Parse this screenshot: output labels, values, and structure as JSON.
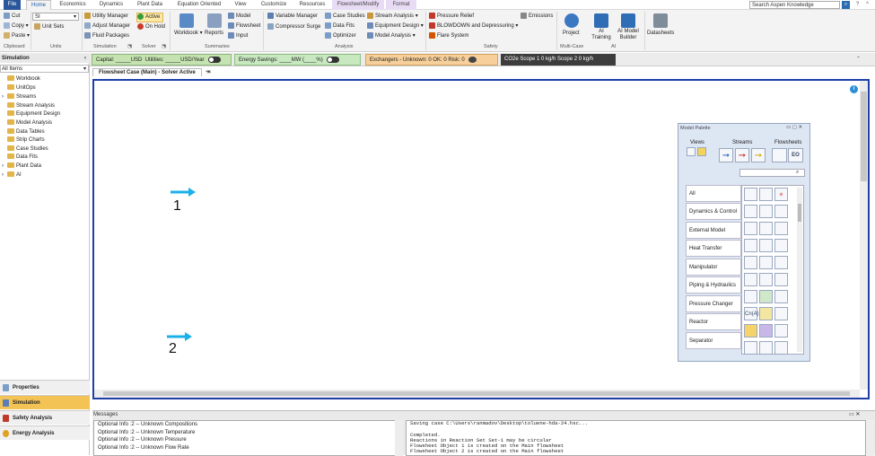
{
  "menu": {
    "tabs": [
      "File",
      "Home",
      "Economics",
      "Dynamics",
      "Plant Data",
      "Equation Oriented",
      "View",
      "Customize",
      "Resources",
      "Flowsheet/Modify",
      "Format"
    ],
    "search_placeholder": "Search Aspen Knowledge"
  },
  "ribbon": {
    "clipboard": {
      "cut": "Cut",
      "copy": "Copy",
      "paste": "Paste",
      "label": "Clipboard"
    },
    "units": {
      "value": "SI",
      "unit_sets": "Unit Sets",
      "label": "Units"
    },
    "simulation": {
      "utility_manager": "Utility Manager",
      "adjust_manager": "Adjust Manager",
      "fluid_packages": "Fluid Packages",
      "label": "Simulation"
    },
    "solver": {
      "active": "Active",
      "on_hold": "On Hold",
      "label": "Solver"
    },
    "summaries": {
      "workbook": "Workbook",
      "reports": "Reports",
      "model": "Model",
      "flowsheet": "Flowsheet",
      "input": "Input",
      "label": "Summaries"
    },
    "analysis": {
      "variable_manager": "Variable Manager",
      "compressor_surge": "Compressor Surge",
      "case_studies": "Case Studies",
      "data_fits": "Data Fits",
      "optimizer": "Optimizer",
      "label": "Analysis"
    },
    "analysis2": {
      "stream_analysis": "Stream Analysis",
      "equipment_design": "Equipment Design",
      "model_analysis": "Model Analysis"
    },
    "safety": {
      "pressure_relief": "Pressure Relief",
      "blowdown": "BLOWDOWN and Depressuring",
      "flare_system": "Flare System",
      "label": "Safety"
    },
    "emissions": "Emissions",
    "multicase": {
      "project": "Project",
      "label": "Multi-Case"
    },
    "ai": {
      "training": "AI Training",
      "builder": "AI Model Builder",
      "label": "AI"
    },
    "datasheets": "Datasheets"
  },
  "costbar": {
    "capital": "Capital: _____USD",
    "utilities": "Utilities: _____USD/Year",
    "energy": "Energy Savings: ____MW   (____%)",
    "exchangers": "Exchangers -  Unknown: 0   OK: 0   Risk: 0",
    "co2": "CO2e Scope 1   0 kg/h   Scope 2   0 kg/h"
  },
  "nav": {
    "header": "Simulation",
    "filter": "All Items",
    "items": [
      "Workbook",
      "UnitOps",
      "Streams",
      "Stream Analysis",
      "Equipment Design",
      "Model Analysis",
      "Data Tables",
      "Strip Charts",
      "Case Studies",
      "Data Fits",
      "Plant Data",
      "AI"
    ],
    "buttons": [
      "Properties",
      "Simulation",
      "Safety Analysis",
      "Energy Analysis"
    ]
  },
  "doc": {
    "tab": "Flowsheet Case (Main) - Solver Active"
  },
  "streams": [
    {
      "label": "1"
    },
    {
      "label": "2"
    }
  ],
  "palette": {
    "title": "Model Palette",
    "views": "Views",
    "streams": "Streams",
    "flowsheets": "Flowsheets",
    "categories": [
      "All",
      "Dynamics & Control",
      "External Model",
      "Heat Transfer",
      "Manipulator",
      "Piping & Hydraulics",
      "Pressure Changer",
      "Reactor",
      "Separator"
    ]
  },
  "messages": {
    "title": "Messages",
    "left": [
      "Optional Info :2 -- Unknown Compositions",
      "Optional Info :2 -- Unknown Temperature",
      "Optional Info :2 -- Unknown Pressure",
      "Optional Info :2 -- Unknown Flow Rate"
    ],
    "right": [
      "Saving case C:\\Users\\ranmadov\\Desktop\\toluene-hda-24.hsc...",
      "",
      "Completed.",
      "Reactions in Reaction Set Set-1 may be circular",
      "Flowsheet Object 1 is created on the Main flowsheet",
      "Flowsheet Object 2 is created on the Main flowsheet"
    ]
  },
  "colors": {
    "accent": "#2b579a",
    "stream": "#1ab0e8",
    "canvas_border": "#1f3fa8",
    "sim_selected": "#f4c356"
  }
}
